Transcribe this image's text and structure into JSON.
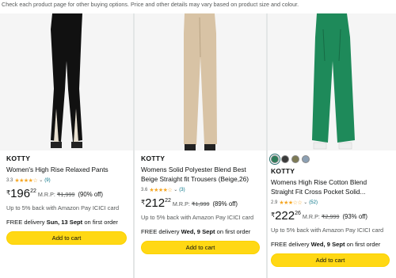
{
  "notice": "Check each product page for other buying options. Price and other details may vary based on product size and colour.",
  "products": [
    {
      "brand": "KOTTY",
      "title": "Women's High Rise Relaxed Pants",
      "rating": "3.3",
      "stars": "★★★★☆",
      "reviews": "(9)",
      "currency": "₹",
      "price_whole": "196",
      "price_frac": "22",
      "mrp_label": "M.R.P:",
      "mrp": "₹1,999",
      "discount": "(90% off)",
      "emi": "Up to 5% back with Amazon Pay ICICI card",
      "delivery_prefix": "FREE delivery ",
      "delivery_date": "Sun, 13 Sept",
      "delivery_suffix": " on first order",
      "cart_label": "Add to cart",
      "pant_color": "#111111"
    },
    {
      "brand": "KOTTY",
      "title": "Womens Solid Polyester Blend Best Beige Straight fit Trousers (Beige,26)",
      "title_line1": "Womens Solid Polyester Blend Best",
      "title_line2": "Beige Straight fit Trousers (Beige,26)",
      "rating": "3.6",
      "stars": "★★★★☆",
      "reviews": "(3)",
      "currency": "₹",
      "price_whole": "212",
      "price_frac": "22",
      "mrp_label": "M.R.P:",
      "mrp": "₹1,999",
      "discount": "(89% off)",
      "emi": "Up to 5% back with Amazon Pay ICICI card",
      "delivery_prefix": "FREE delivery ",
      "delivery_date": "Wed, 9 Sept",
      "delivery_suffix": " on first order",
      "cart_label": "Add to cart",
      "pant_color": "#d8c3a5"
    },
    {
      "brand": "KOTTY",
      "title_line1": "Womens High Rise Cotton Blend",
      "title_line2": "Straight Fit Cross Pocket Solid...",
      "rating": "2.9",
      "stars": "★★★☆☆",
      "reviews": "(52)",
      "currency": "₹",
      "price_whole": "222",
      "price_frac": "26",
      "mrp_label": "M.R.P:",
      "mrp": "₹2,999",
      "discount": "(93% off)",
      "emi": "Up to 5% back with Amazon Pay ICICI card",
      "delivery_prefix": "FREE delivery ",
      "delivery_date": "Wed, 9 Sept",
      "delivery_suffix": " on first order",
      "cart_label": "Add to cart",
      "pant_color": "#1e8a5a",
      "swatches": [
        "#2e7d5a",
        "#3a3a3a",
        "#7d7a55",
        "#8ca0b3"
      ]
    }
  ]
}
